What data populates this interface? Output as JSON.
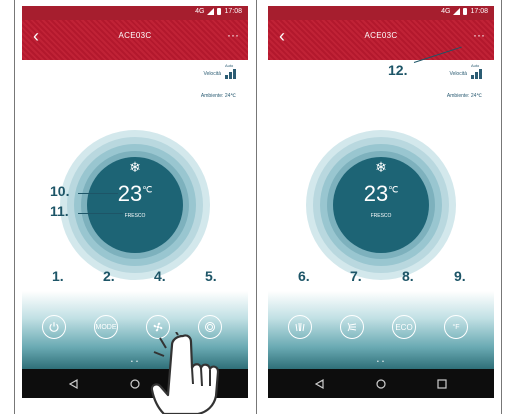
{
  "status": {
    "network": "4G",
    "time": "17:08"
  },
  "app": {
    "title": "ACE03C"
  },
  "top_info": {
    "speed_label": "Velocità",
    "speed_mode": "Auto",
    "ambient": "Ambiente: 24℃"
  },
  "dial": {
    "temperature": "23",
    "unit": "℃",
    "mode": "FRESCO"
  },
  "left_buttons": {
    "mode": "MODE"
  },
  "right_buttons": {
    "eco": "ECO",
    "fahrenheit": "°F"
  },
  "page_dots": "• •",
  "callouts": {
    "power": "1.",
    "mode": "2.",
    "fan": "4.",
    "swing": "5.",
    "v_swing": "6.",
    "h_swing": "7.",
    "eco": "8.",
    "unit": "9.",
    "temperature": "10.",
    "mode_text": "11.",
    "menu": "12."
  },
  "icons": {
    "back": "back-arrow-icon",
    "more": "more-dots-icon",
    "snowflake": "snowflake-icon",
    "hand": "pointing-hand-icon"
  }
}
